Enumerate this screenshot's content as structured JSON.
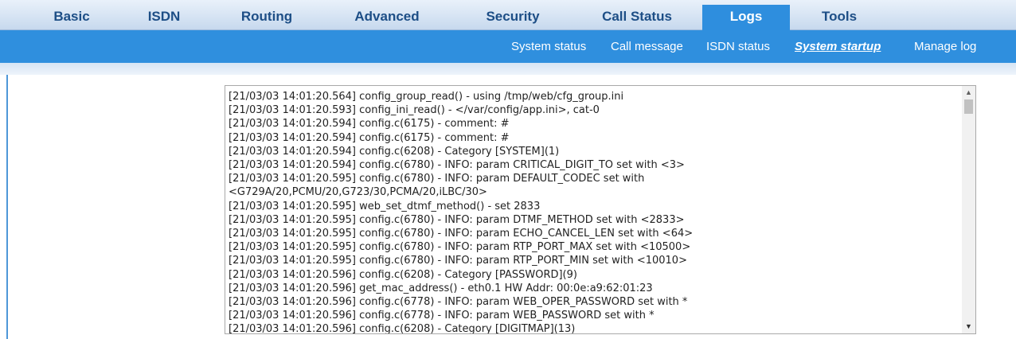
{
  "topnav": {
    "tabs": [
      {
        "label": "Basic"
      },
      {
        "label": "ISDN"
      },
      {
        "label": "Routing"
      },
      {
        "label": "Advanced"
      },
      {
        "label": "Security"
      },
      {
        "label": "Call Status"
      },
      {
        "label": "Logs",
        "active": true
      },
      {
        "label": "Tools"
      }
    ]
  },
  "subnav": {
    "items": [
      {
        "label": "System status"
      },
      {
        "label": "Call message"
      },
      {
        "label": "ISDN status"
      },
      {
        "label": "System startup",
        "active": true
      },
      {
        "label": "Manage log"
      }
    ]
  },
  "log": {
    "lines": [
      "[21/03/03 14:01:20.564] config_group_read() - using /tmp/web/cfg_group.ini",
      "[21/03/03 14:01:20.593] config_ini_read() - </var/config/app.ini>, cat-0",
      "[21/03/03 14:01:20.594] config.c(6175) - comment: #",
      "[21/03/03 14:01:20.594] config.c(6175) - comment: #",
      "[21/03/03 14:01:20.594] config.c(6208) - Category [SYSTEM](1)",
      "[21/03/03 14:01:20.594] config.c(6780) - INFO: param CRITICAL_DIGIT_TO set with <3>",
      "[21/03/03 14:01:20.595] config.c(6780) - INFO: param DEFAULT_CODEC set with",
      "<G729A/20,PCMU/20,G723/30,PCMA/20,iLBC/30>",
      "[21/03/03 14:01:20.595] web_set_dtmf_method() - set 2833",
      "[21/03/03 14:01:20.595] config.c(6780) - INFO: param DTMF_METHOD set with <2833>",
      "[21/03/03 14:01:20.595] config.c(6780) - INFO: param ECHO_CANCEL_LEN set with <64>",
      "[21/03/03 14:01:20.595] config.c(6780) - INFO: param RTP_PORT_MAX set with <10500>",
      "[21/03/03 14:01:20.595] config.c(6780) - INFO: param RTP_PORT_MIN set with <10010>",
      "[21/03/03 14:01:20.596] config.c(6208) - Category [PASSWORD](9)",
      "[21/03/03 14:01:20.596] get_mac_address() - eth0.1 HW Addr: 00:0e:a9:62:01:23",
      "[21/03/03 14:01:20.596] config.c(6778) - INFO: param WEB_OPER_PASSWORD set with *",
      "[21/03/03 14:01:20.596] config.c(6778) - INFO: param WEB_PASSWORD set with *",
      "[21/03/03 14:01:20.596] config.c(6208) - Category [DIGITMAP](13)"
    ]
  },
  "scrollbar": {
    "up_icon": "triangle-up-icon",
    "down_icon": "triangle-down-icon",
    "position": 0
  },
  "colors": {
    "nav_blue": "#2f8fde",
    "tab_text": "#1d4e86"
  }
}
